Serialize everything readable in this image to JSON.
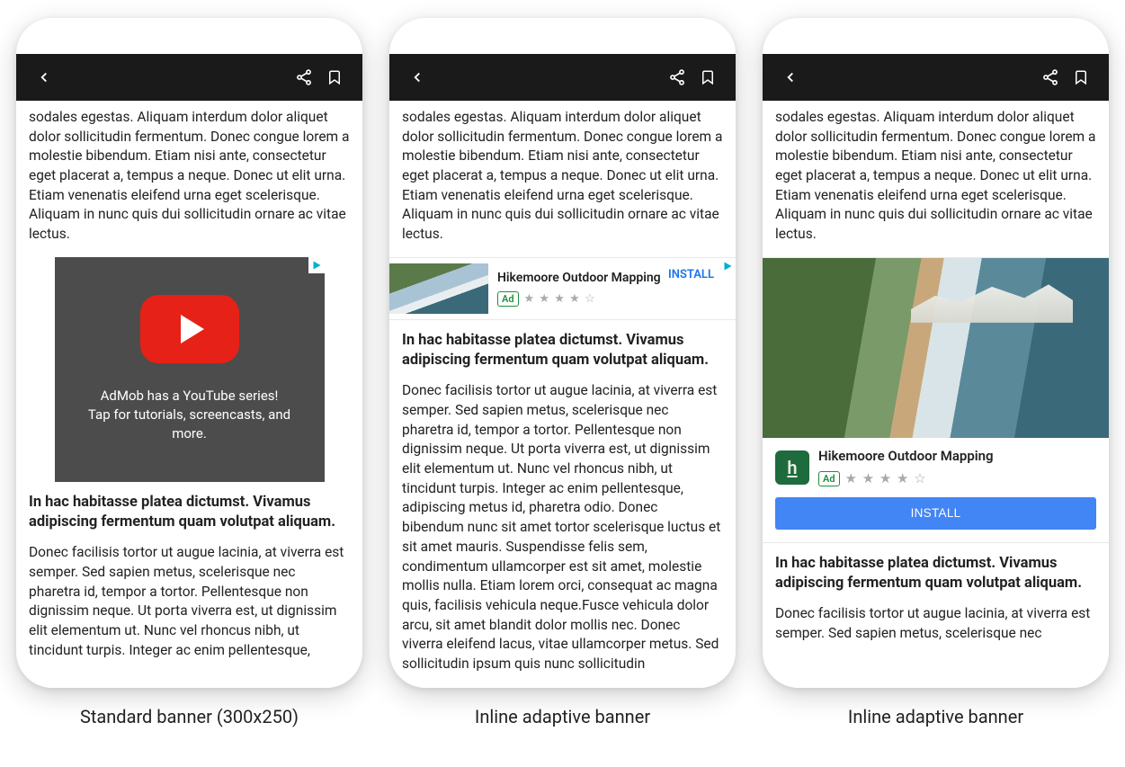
{
  "captions": {
    "phone1": "Standard banner (300x250)",
    "phone2": "Inline adaptive banner",
    "phone3": "Inline adaptive banner"
  },
  "lorem": {
    "top": "sodales egestas. Aliquam interdum dolor aliquet dolor sollicitudin fermentum. Donec congue lorem a molestie bibendum. Etiam nisi ante, consectetur eget placerat a, tempus a neque. Donec ut elit urna. Etiam venenatis eleifend urna eget scelerisque. Aliquam in nunc quis dui sollicitudin ornare ac vitae lectus.",
    "heading": "In hac habitasse platea dictumst. Vivamus adipiscing fermentum quam volutpat aliquam.",
    "body_long": "Donec facilisis tortor ut augue lacinia, at viverra est semper. Sed sapien metus, scelerisque nec pharetra id, tempor a tortor. Pellentesque non dignissim neque. Ut porta viverra est, ut dignissim elit elementum ut. Nunc vel rhoncus nibh, ut tincidunt turpis. Integer ac enim pellentesque, adipiscing metus id, pharetra odio. Donec bibendum nunc sit amet tortor scelerisque luctus et sit amet mauris. Suspendisse felis sem, condimentum ullamcorper est sit amet, molestie mollis nulla. Etiam lorem orci, consequat ac magna quis, facilisis vehicula neque.Fusce vehicula dolor arcu, sit amet blandit dolor mollis nec. Donec viverra eleifend lacus, vitae ullamcorper metus. Sed sollicitudin ipsum quis nunc sollicitudin",
    "body_med": "Donec facilisis tortor ut augue lacinia, at viverra est semper. Sed sapien metus, scelerisque nec pharetra id, tempor a tortor. Pellentesque non dignissim neque. Ut porta viverra est, ut dignissim elit elementum ut. Nunc vel rhoncus nibh, ut tincidunt turpis. Integer ac enim pellentesque,",
    "body_short": "Donec facilisis tortor ut augue lacinia, at viverra est semper. Sed sapien metus, scelerisque nec"
  },
  "ads": {
    "youtube": {
      "line1": "AdMob has a YouTube series!",
      "line2": "Tap for tutorials, screencasts, and more."
    },
    "hikemoore": {
      "title": "Hikemoore Outdoor Mapping",
      "badge": "Ad",
      "stars_small": "★ ★ ★ ★ ☆",
      "stars_large": "★ ★ ★ ★ ☆",
      "install": "INSTALL",
      "app_letter": "h"
    }
  }
}
